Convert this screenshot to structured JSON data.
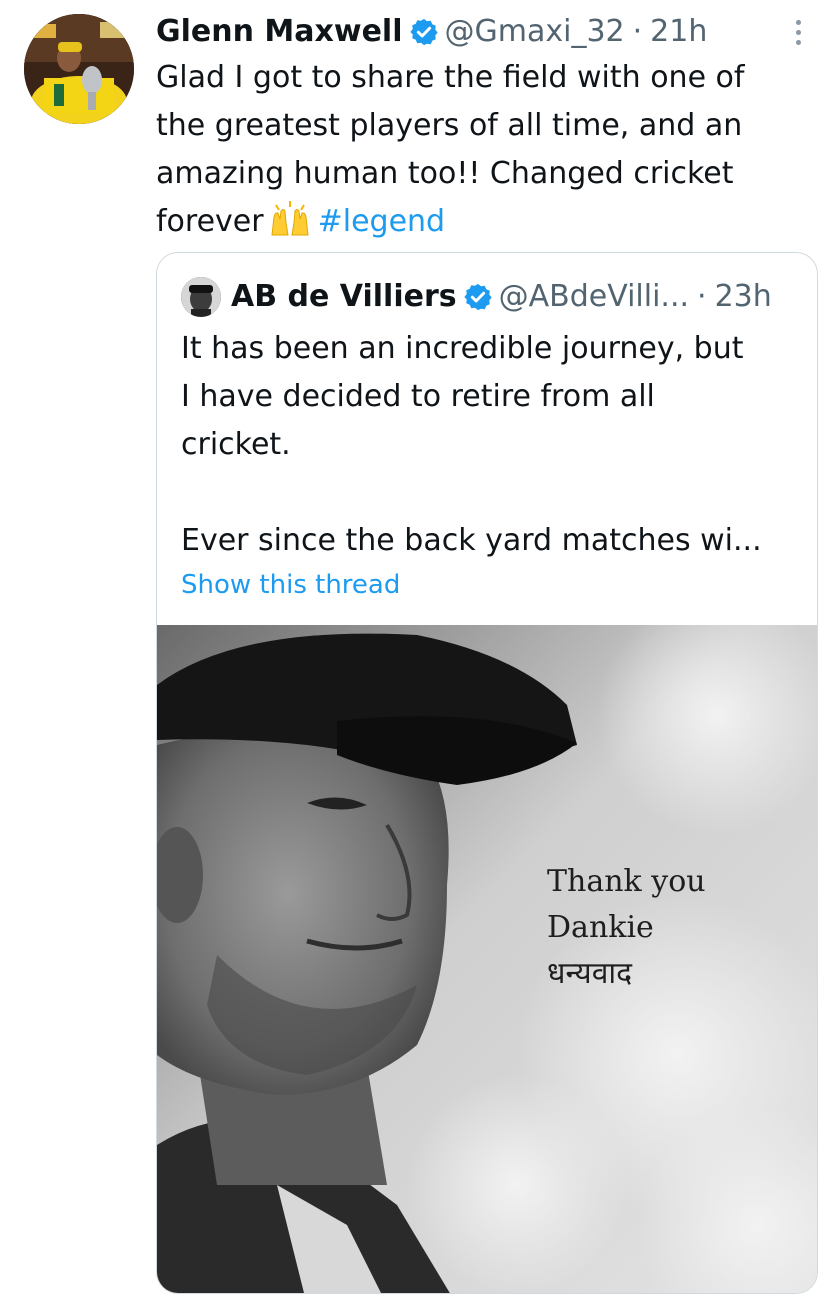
{
  "tweet": {
    "author": {
      "display_name": "Glenn Maxwell",
      "handle": "@Gmaxi_32",
      "time": "21h",
      "verified": true
    },
    "separator": "·",
    "text_lines": [
      "Glad I got to share the field with one of",
      "the greatest players of all time, and an",
      "amazing human too!! Changed cricket",
      "forever"
    ],
    "emoji": "raising-hands-emoji",
    "hashtag": "#legend"
  },
  "quoted_tweet": {
    "author": {
      "display_name": "AB de Villiers",
      "handle": "@ABdeVilli...",
      "time": "23h",
      "verified": true
    },
    "separator": "·",
    "text_lines": [
      "It has been an incredible journey, but",
      "I have decided to retire from all",
      "cricket."
    ],
    "text_continuation": "Ever since the back yard matches wi...",
    "show_thread": "Show this thread",
    "image_overlay": [
      "Thank you",
      "Dankie",
      "धन्यवाद"
    ]
  },
  "icons": {
    "verified": "verified-badge-icon",
    "more": "more-options-icon"
  },
  "colors": {
    "link": "#1d9bf0",
    "verified": "#1d9bf0",
    "secondary_text": "#536471",
    "border": "#cfd9de"
  }
}
